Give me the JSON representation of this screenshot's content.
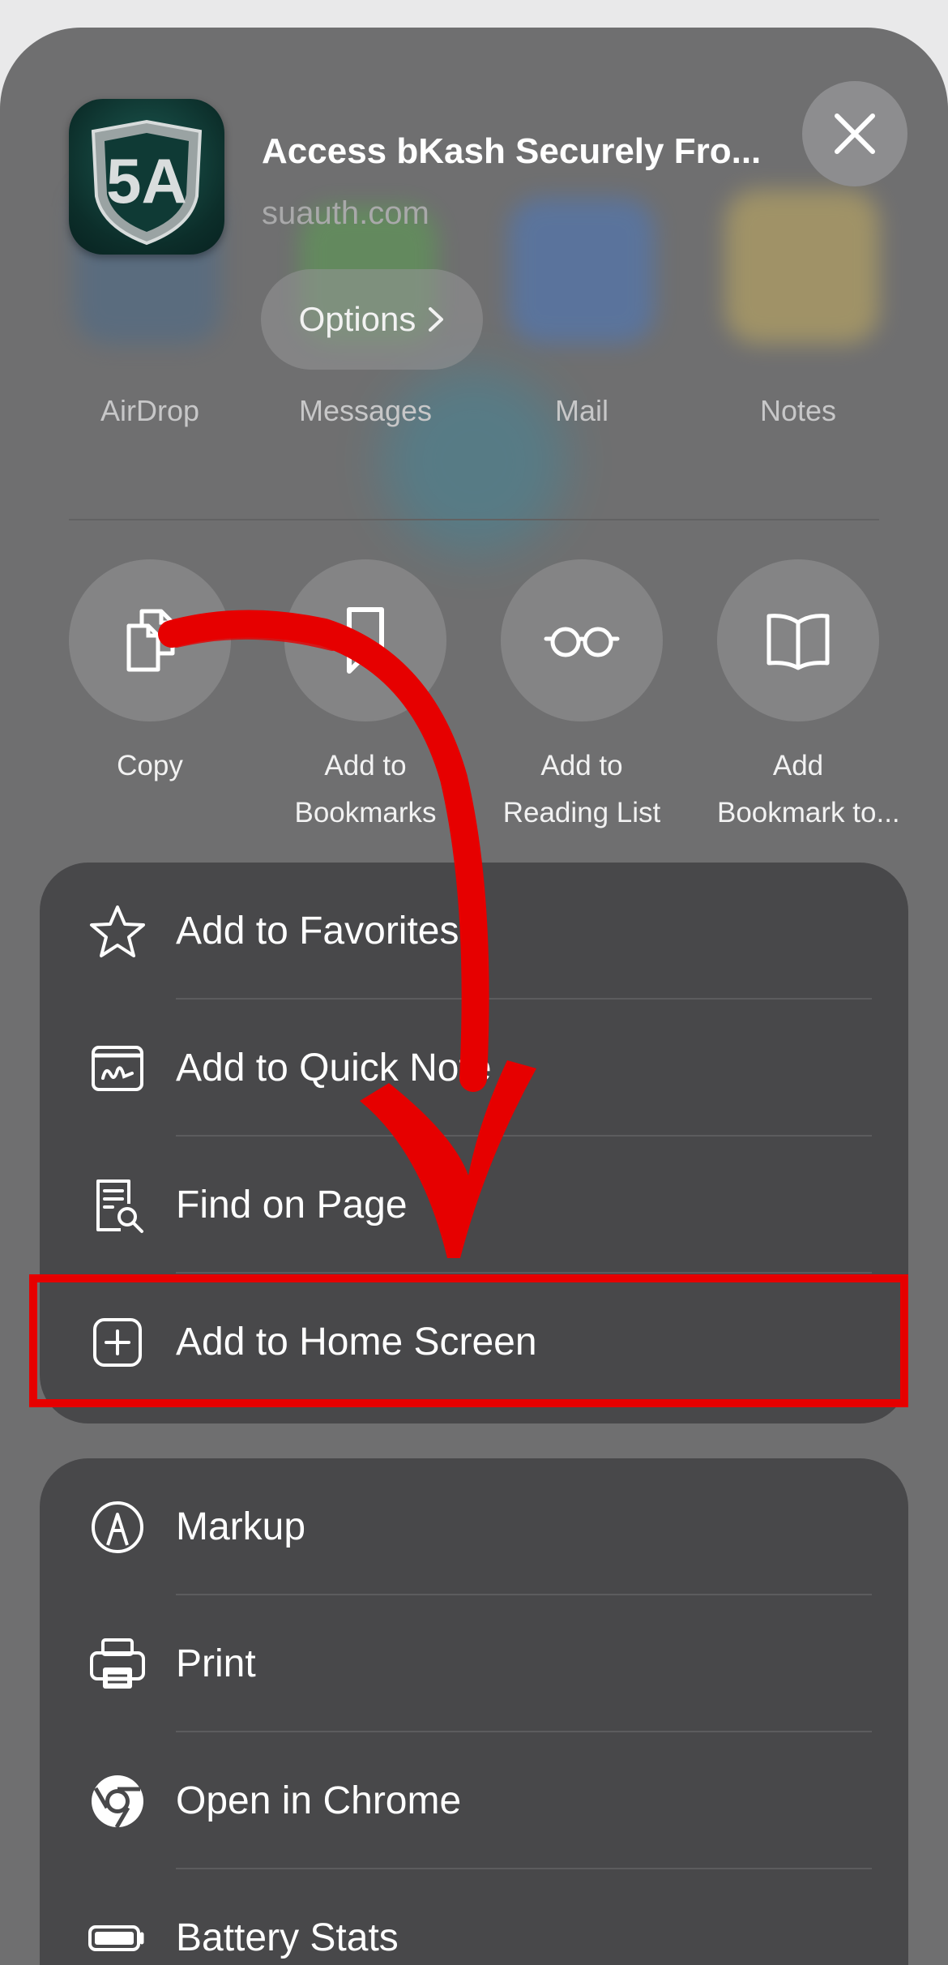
{
  "header": {
    "title": "Access bKash Securely Fro...",
    "domain": "suauth.com",
    "options_label": "Options",
    "app_icon_letters": "5A"
  },
  "share_targets": [
    {
      "label": "AirDrop"
    },
    {
      "label": "Messages"
    },
    {
      "label": "Mail"
    },
    {
      "label": "Notes"
    }
  ],
  "actions": [
    {
      "line1": "Copy",
      "line2": ""
    },
    {
      "line1": "Add to",
      "line2": "Bookmarks"
    },
    {
      "line1": "Add to",
      "line2": "Reading List"
    },
    {
      "line1": "Add",
      "line2": "Bookmark to..."
    }
  ],
  "menu_group_1": [
    {
      "label": "Add to Favorites",
      "icon": "star-icon"
    },
    {
      "label": "Add to Quick Note",
      "icon": "quick-note-icon"
    },
    {
      "label": "Find on Page",
      "icon": "find-on-page-icon"
    },
    {
      "label": "Add to Home Screen",
      "icon": "plus-square-icon"
    }
  ],
  "menu_group_2": [
    {
      "label": "Markup",
      "icon": "markup-icon"
    },
    {
      "label": "Print",
      "icon": "printer-icon"
    },
    {
      "label": "Open in Chrome",
      "icon": "chrome-icon"
    },
    {
      "label": "Battery Stats",
      "icon": "battery-icon"
    }
  ],
  "colors": {
    "highlight": "#e60000",
    "arrow": "#e60000",
    "menu_background": "#48484a",
    "sheet_background": "#6f6f70"
  }
}
